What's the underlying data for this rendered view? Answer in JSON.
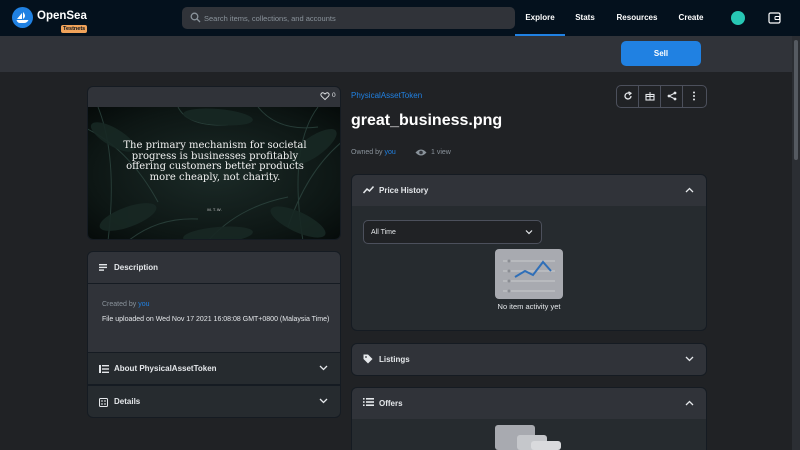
{
  "nav": {
    "brand": "OpenSea",
    "badge": "Testnets",
    "search_placeholder": "Search items, collections, and accounts",
    "links": [
      "Explore",
      "Stats",
      "Resources",
      "Create"
    ],
    "active_link": "Explore"
  },
  "actions": {
    "sell": "Sell"
  },
  "asset": {
    "collection": "PhysicalAssetToken",
    "name": "great_business.png",
    "likes": "0",
    "owned_prefix": "Owned by",
    "owner": "you",
    "views": "1 view",
    "image_quote": "The primary mechanism for societal progress is businesses profitably offering customers better products more cheaply, not charity.",
    "image_author": "M.T.W."
  },
  "left_panels": {
    "description_title": "Description",
    "created_prefix": "Created by",
    "creator": "you",
    "uploaded_text": "File uploaded on Wed Nov 17 2021 16:08:08 GMT+0800 (Malaysia Time)",
    "about_title": "About PhysicalAssetToken",
    "details_title": "Details"
  },
  "price_history": {
    "title": "Price History",
    "filter_value": "All Time",
    "empty_text": "No item activity yet"
  },
  "listings": {
    "title": "Listings"
  },
  "offers": {
    "title": "Offers"
  },
  "colors": {
    "accent": "#2081e2",
    "nav_bg": "#04111d",
    "panel_bg": "#303339",
    "page_bg": "#202225"
  }
}
